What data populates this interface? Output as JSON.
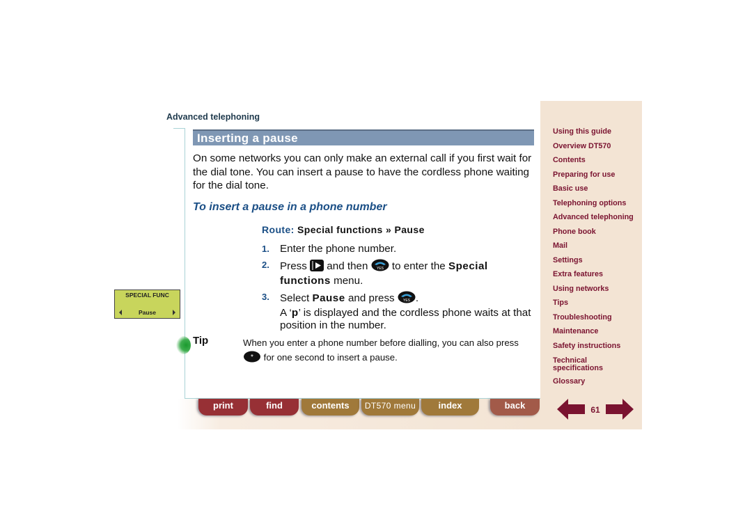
{
  "header": {
    "section": "Advanced telephoning"
  },
  "page": {
    "title": "Inserting a pause",
    "intro": "On some networks you can only make an external call if you first wait for the dial tone. You can insert a pause to have the cordless phone waiting for the dial tone.",
    "subheading": "To insert a pause in a phone number",
    "route": {
      "label": "Route:",
      "path": "Special functions » Pause"
    },
    "steps": [
      {
        "num": "1.",
        "text": "Enter the phone number."
      },
      {
        "num": "2.",
        "pre": "Press",
        "mid": "and then",
        "post": "to enter the",
        "bold1": "Special",
        "bold2": "functions",
        "end": "menu.",
        "icons": [
          "menu-key-icon",
          "yes-key-icon"
        ]
      },
      {
        "num": "3.",
        "pre": "Select",
        "bold": "Pause",
        "mid": "and press",
        "end": ".",
        "line2a": "A ‘",
        "line2b": "p",
        "line2c": "’ is displayed and the cordless phone waits at that position in the number.",
        "icons": [
          "yes-key-icon"
        ]
      }
    ],
    "tip": {
      "label": "Tip",
      "text1": "When you enter a phone number before dialling, you can also press",
      "text2": "for one second to insert a pause.",
      "icon": "star-key-icon"
    }
  },
  "lcd": {
    "title": "SPECIAL FUNC",
    "value": "Pause"
  },
  "nav": {
    "buttons": [
      {
        "label": "print",
        "style": "red"
      },
      {
        "label": "find",
        "style": "red"
      },
      {
        "label": "contents",
        "style": "gold"
      },
      {
        "label": "DT570 menu",
        "style": "gold"
      },
      {
        "label": "index",
        "style": "gold"
      },
      {
        "label": "back",
        "style": "rust"
      }
    ]
  },
  "sidebar": {
    "items": [
      "Using this guide",
      "Overview DT570",
      "Contents",
      "Preparing for use",
      "Basic use",
      "Telephoning options",
      "Advanced telephoning",
      "Phone book",
      "Mail",
      "Settings",
      "Extra features",
      "Using networks",
      "Tips",
      "Troubleshooting",
      "Maintenance",
      "Safety instructions",
      "Technical specifications",
      "Glossary"
    ]
  },
  "pager": {
    "page_number": "61",
    "prev": "previous-page",
    "next": "next-page"
  },
  "colors": {
    "title_bar": "#7f97b4",
    "heading_blue": "#1b4f86",
    "sidebar_link": "#7a1330",
    "sidebar_bg": "#f3e4d4"
  }
}
